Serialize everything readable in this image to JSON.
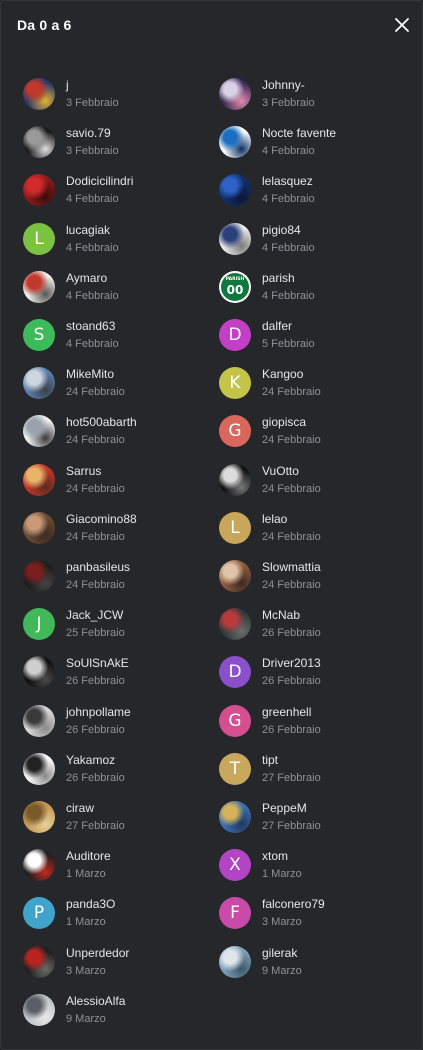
{
  "dialog": {
    "title": "Da 0 a 6",
    "close_icon": "close-icon"
  },
  "users": [
    {
      "name": "j",
      "date": "3 Febbraio",
      "avatar": {
        "type": "image",
        "colors": [
          "#2a3a6b",
          "#c0392b",
          "#e6b233"
        ]
      }
    },
    {
      "name": "Johnny-",
      "date": "3 Febbraio",
      "avatar": {
        "type": "image",
        "colors": [
          "#3b2b55",
          "#d9d2e6",
          "#e58bb0"
        ]
      }
    },
    {
      "name": "savio.79",
      "date": "3 Febbraio",
      "avatar": {
        "type": "image",
        "colors": [
          "#1b1b1b",
          "#9a9a9a",
          "#e0e0e0"
        ]
      }
    },
    {
      "name": "Nocte favente",
      "date": "4 Febbraio",
      "avatar": {
        "type": "image",
        "colors": [
          "#ffffff",
          "#1b6ec2",
          "#0c2f62"
        ]
      }
    },
    {
      "name": "Dodicicilindri",
      "date": "4 Febbraio",
      "avatar": {
        "type": "image",
        "colors": [
          "#8d1a1a",
          "#d12b2b",
          "#3a0c0c"
        ]
      }
    },
    {
      "name": "lelasquez",
      "date": "4 Febbraio",
      "avatar": {
        "type": "image",
        "colors": [
          "#13306b",
          "#2d63c9",
          "#0b1736"
        ]
      }
    },
    {
      "name": "lucagiak",
      "date": "4 Febbraio",
      "avatar": {
        "type": "letter",
        "letter": "L",
        "colors": [
          "#7cc242"
        ]
      }
    },
    {
      "name": "pigio84",
      "date": "4 Febbraio",
      "avatar": {
        "type": "image",
        "colors": [
          "#e9e9e9",
          "#2b3f7a",
          "#7a7a7a"
        ]
      }
    },
    {
      "name": "Aymaro",
      "date": "4 Febbraio",
      "avatar": {
        "type": "image",
        "colors": [
          "#f2efe9",
          "#c0392b",
          "#555555"
        ]
      }
    },
    {
      "name": "parish",
      "date": "4 Febbraio",
      "avatar": {
        "type": "jersey",
        "text": "PARISH",
        "number": "00",
        "colors": [
          "#10773e",
          "#ffffff"
        ]
      }
    },
    {
      "name": "stoand63",
      "date": "4 Febbraio",
      "avatar": {
        "type": "letter",
        "letter": "S",
        "colors": [
          "#3dbb5a"
        ]
      }
    },
    {
      "name": "dalfer",
      "date": "5 Febbraio",
      "avatar": {
        "type": "letter",
        "letter": "D",
        "colors": [
          "#c23fc6"
        ]
      }
    },
    {
      "name": "MikeMito",
      "date": "24 Febbraio",
      "avatar": {
        "type": "image",
        "colors": [
          "#5c7fb0",
          "#cfd6df",
          "#3a3f47"
        ]
      }
    },
    {
      "name": "Kangoo",
      "date": "24 Febbraio",
      "avatar": {
        "type": "letter",
        "letter": "K",
        "colors": [
          "#c4c44a"
        ]
      }
    },
    {
      "name": "hot500abarth",
      "date": "24 Febbraio",
      "avatar": {
        "type": "image",
        "colors": [
          "#f0f0f0",
          "#9aa3ad",
          "#3a3a3a"
        ]
      }
    },
    {
      "name": "giopisca",
      "date": "24 Febbraio",
      "avatar": {
        "type": "letter",
        "letter": "G",
        "colors": [
          "#d9675b"
        ]
      }
    },
    {
      "name": "Sarrus",
      "date": "24 Febbraio",
      "avatar": {
        "type": "image",
        "colors": [
          "#c0352a",
          "#e8b46a",
          "#5a2b20"
        ]
      }
    },
    {
      "name": "VuOtto",
      "date": "24 Febbraio",
      "avatar": {
        "type": "image",
        "colors": [
          "#111111",
          "#dcdcdc",
          "#777777"
        ]
      }
    },
    {
      "name": "Giacomino88",
      "date": "24 Febbraio",
      "avatar": {
        "type": "image",
        "colors": [
          "#6b4a33",
          "#c89a77",
          "#3a2a20"
        ]
      }
    },
    {
      "name": "lelao",
      "date": "24 Febbraio",
      "avatar": {
        "type": "letter",
        "letter": "L",
        "colors": [
          "#c8a65a"
        ]
      }
    },
    {
      "name": "panbasileus",
      "date": "24 Febbraio",
      "avatar": {
        "type": "image",
        "colors": [
          "#1d1d1d",
          "#7a1e1e",
          "#444444"
        ]
      }
    },
    {
      "name": "Slowmattia",
      "date": "24 Febbraio",
      "avatar": {
        "type": "image",
        "colors": [
          "#8c5a3c",
          "#e0c3a8",
          "#3c2a22"
        ]
      }
    },
    {
      "name": "Jack_JCW",
      "date": "25 Febbraio",
      "avatar": {
        "type": "letter",
        "letter": "J",
        "colors": [
          "#41b85a"
        ]
      }
    },
    {
      "name": "McNab",
      "date": "26 Febbraio",
      "avatar": {
        "type": "image",
        "colors": [
          "#2f3a3a",
          "#b83a3a",
          "#6b6b6b"
        ]
      }
    },
    {
      "name": "SoUlSnAkE",
      "date": "26 Febbraio",
      "avatar": {
        "type": "image",
        "colors": [
          "#0f0f0f",
          "#cfcfcf",
          "#4a4a4a"
        ]
      }
    },
    {
      "name": "Driver2013",
      "date": "26 Febbraio",
      "avatar": {
        "type": "letter",
        "letter": "D",
        "colors": [
          "#8a4fcb"
        ]
      }
    },
    {
      "name": "johnpollame",
      "date": "26 Febbraio",
      "avatar": {
        "type": "image",
        "colors": [
          "#d8d8d8",
          "#3a3a3a",
          "#8a8a8a"
        ]
      }
    },
    {
      "name": "greenhell",
      "date": "26 Febbraio",
      "avatar": {
        "type": "letter",
        "letter": "G",
        "colors": [
          "#d54f8e"
        ]
      }
    },
    {
      "name": "Yakamoz",
      "date": "26 Febbraio",
      "avatar": {
        "type": "image",
        "colors": [
          "#ffffff",
          "#222222",
          "#888888"
        ]
      }
    },
    {
      "name": "tipt",
      "date": "27 Febbraio",
      "avatar": {
        "type": "letter",
        "letter": "T",
        "colors": [
          "#c9a85c"
        ]
      }
    },
    {
      "name": "ciraw",
      "date": "27 Febbraio",
      "avatar": {
        "type": "image",
        "colors": [
          "#c59a55",
          "#7a5a2a",
          "#e8cf9a"
        ]
      }
    },
    {
      "name": "PeppeM",
      "date": "27 Febbraio",
      "avatar": {
        "type": "image",
        "colors": [
          "#3b6fb0",
          "#d6b35a",
          "#1f3760"
        ]
      }
    },
    {
      "name": "Auditore",
      "date": "1 Marzo",
      "avatar": {
        "type": "image",
        "colors": [
          "#1e1e1e",
          "#ffffff",
          "#c0281f"
        ]
      }
    },
    {
      "name": "xtom",
      "date": "1 Marzo",
      "avatar": {
        "type": "letter",
        "letter": "X",
        "colors": [
          "#b444c6"
        ]
      }
    },
    {
      "name": "panda3O",
      "date": "1 Marzo",
      "avatar": {
        "type": "letter",
        "letter": "P",
        "colors": [
          "#3fa3cc"
        ]
      }
    },
    {
      "name": "falconero79",
      "date": "3 Marzo",
      "avatar": {
        "type": "letter",
        "letter": "F",
        "colors": [
          "#c94aa8"
        ]
      }
    },
    {
      "name": "Unperdedor",
      "date": "3 Marzo",
      "avatar": {
        "type": "image",
        "colors": [
          "#1f1f1f",
          "#b8231f",
          "#6a6a6a"
        ]
      }
    },
    {
      "name": "gilerak",
      "date": "9 Marzo",
      "avatar": {
        "type": "image",
        "colors": [
          "#7aa0b8",
          "#e0e6ea",
          "#3e5668"
        ]
      }
    },
    {
      "name": "AlessioAlfa",
      "date": "9 Marzo",
      "avatar": {
        "type": "image",
        "colors": [
          "#bfc4c8",
          "#5a5f66",
          "#e8e8e8"
        ]
      }
    }
  ]
}
